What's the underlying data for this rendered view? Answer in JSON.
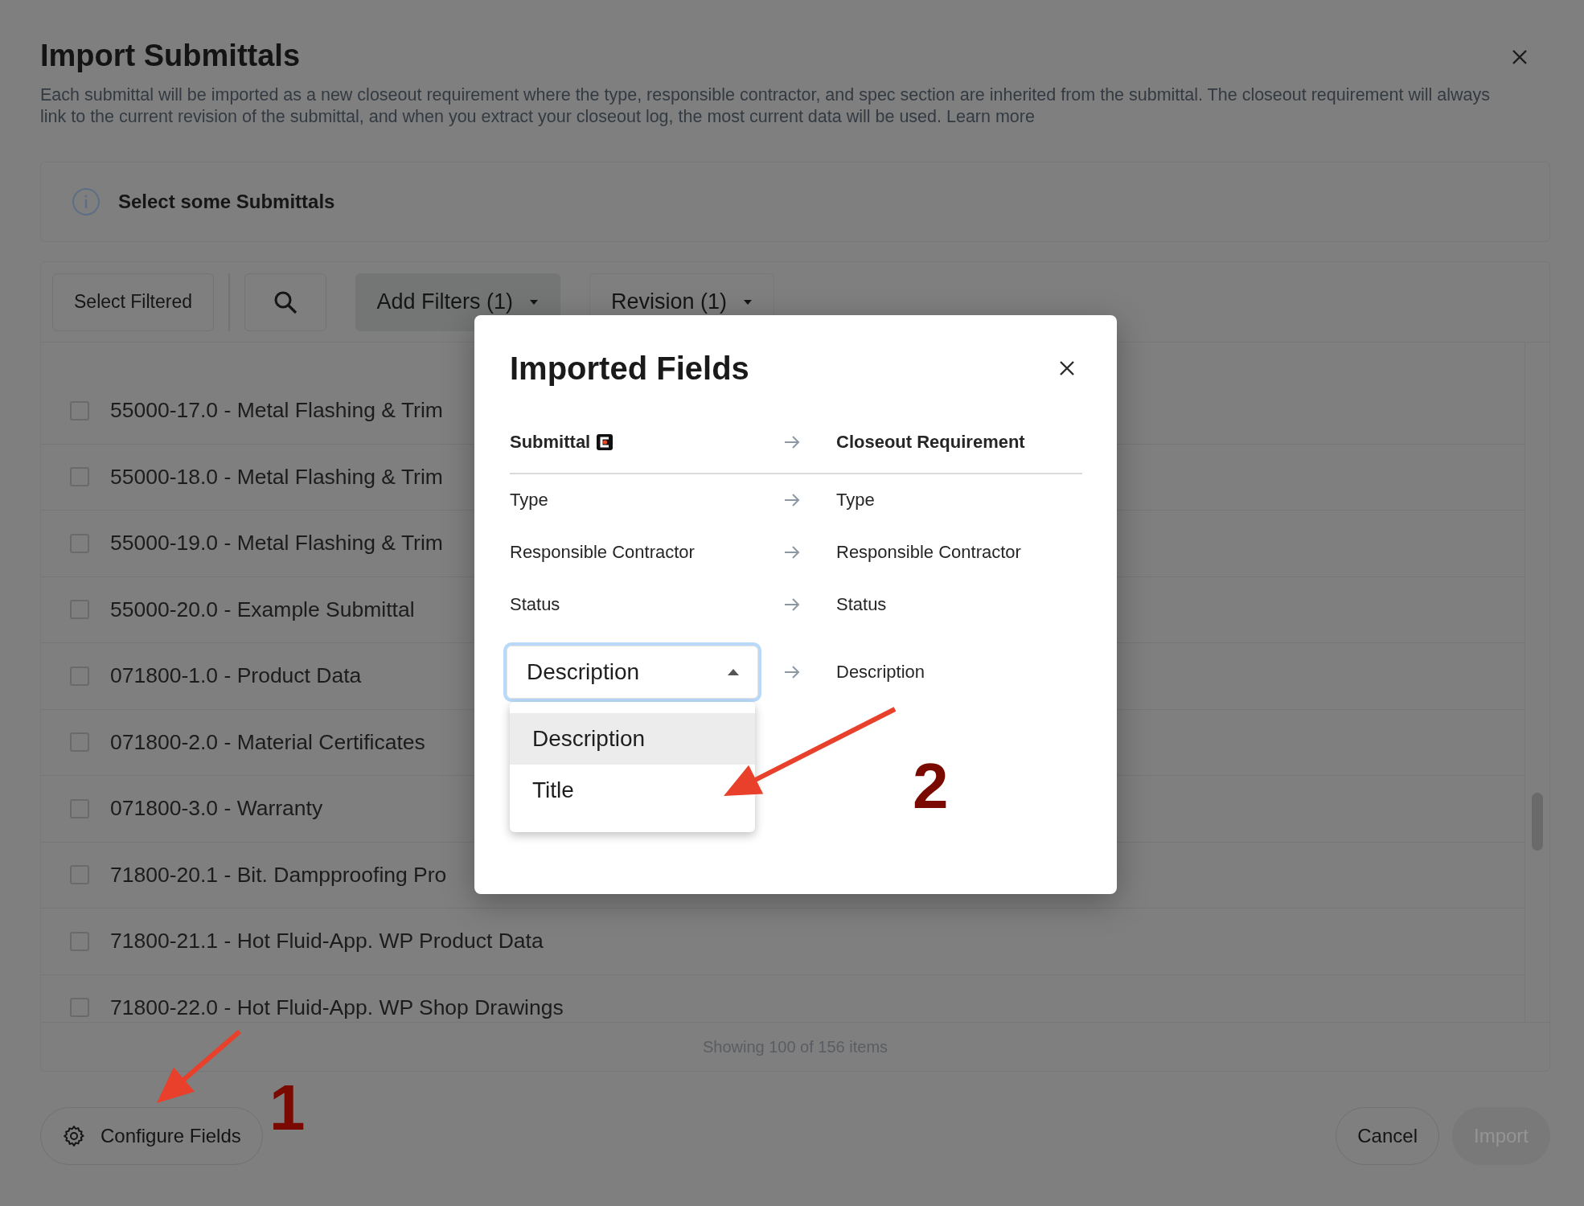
{
  "dialog": {
    "title": "Import Submittals",
    "description": "Each submittal will be imported as a new closeout requirement where the type, responsible contractor, and spec section are inherited from the submittal. The closeout requirement will always link to the current revision of the submittal, and when you extract your closeout log, the most current data will be used.",
    "link": "Learn more"
  },
  "notice": "Select some Submittals",
  "toolbar": [
    {
      "kind": "button",
      "label": "Select Filtered"
    },
    {
      "kind": "search"
    },
    {
      "kind": "filled_dropdown",
      "label": "Add Filters (1)"
    },
    {
      "kind": "outline_dropdown",
      "label": "Revision (1)"
    }
  ],
  "rows": [
    {
      "label": "55000-17.0 - Metal Flashing & Trim",
      "checked": false
    },
    {
      "label": "55000-18.0 - Metal Flashing & Trim",
      "checked": false
    },
    {
      "label": "55000-19.0 - Metal Flashing & Trim",
      "checked": false
    },
    {
      "label": "55000-20.0 - Example Submittal",
      "checked": false
    },
    {
      "label": "071800-1.0 - Product Data",
      "checked": false
    },
    {
      "label": "071800-2.0 - Material Certificates",
      "checked": false
    },
    {
      "label": "071800-3.0 - Warranty",
      "checked": false
    },
    {
      "label": "71800-20.1 - Bit. Dampproofing Pro",
      "checked": false
    },
    {
      "label": "71800-21.1 - Hot Fluid-App. WP Product Data",
      "checked": false
    },
    {
      "label": "71800-22.0 - Hot Fluid-App. WP Shop Drawings",
      "checked": false
    }
  ],
  "footer_count": "Showing 100 of 156 items",
  "configure_button": "Configure Fields",
  "cancel_button": "Cancel",
  "import_button": {
    "label": "Import",
    "disabled": true
  },
  "modal": {
    "title": "Imported Fields",
    "source_header": "Submittal",
    "target_header": "Closeout Requirement",
    "mappings": [
      {
        "kind": "text",
        "source": "Type",
        "target": "Type"
      },
      {
        "kind": "text",
        "source": "Responsible Contractor",
        "target": "Responsible Contractor"
      },
      {
        "kind": "text",
        "source": "Status",
        "target": "Status"
      },
      {
        "kind": "select",
        "source": "Description",
        "target": "Description",
        "expanded": true,
        "options": [
          {
            "label": "Description",
            "selected": true
          },
          {
            "label": "Title",
            "selected": false
          }
        ]
      }
    ]
  },
  "annotations": [
    {
      "label": "1"
    },
    {
      "label": "2"
    }
  ]
}
